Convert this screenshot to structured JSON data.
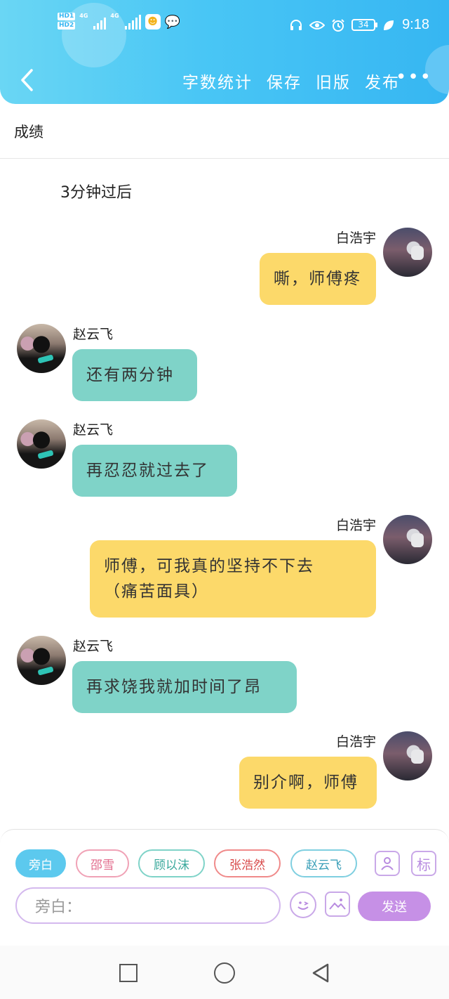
{
  "statusbar": {
    "hd1": "HD1",
    "hd2": "HD2",
    "network1": "4G",
    "network2": "4G",
    "battery": "34",
    "time": "9:18",
    "icons": [
      "headphones-icon",
      "eye-icon",
      "alarm-icon",
      "leaf-icon"
    ]
  },
  "toolbar": {
    "actions": [
      "字数统计",
      "保存",
      "旧版",
      "发布"
    ],
    "more": "•••"
  },
  "document": {
    "title": "成绩"
  },
  "chat": {
    "narration": "3分钟过后",
    "messages": [
      {
        "speaker": "白浩宇",
        "side": "right",
        "text_lines": [
          "嘶，师傅疼"
        ]
      },
      {
        "speaker": "赵云飞",
        "side": "left",
        "text_lines": [
          "还有两分钟"
        ]
      },
      {
        "speaker": "赵云飞",
        "side": "left",
        "text_lines": [
          "再忍忍就过去了"
        ]
      },
      {
        "speaker": "白浩宇",
        "side": "right",
        "text_lines": [
          "师傅，可我真的坚持不下去",
          "（痛苦面具）"
        ]
      },
      {
        "speaker": "赵云飞",
        "side": "left",
        "text_lines": [
          "再求饶我就加时间了昂"
        ]
      },
      {
        "speaker": "白浩宇",
        "side": "right",
        "text_lines": [
          "别介啊，师傅"
        ]
      }
    ]
  },
  "composer": {
    "roles": [
      "旁白",
      "邵雪",
      "顾以沫",
      "张浩然",
      "赵云飞"
    ],
    "active_role": "旁白",
    "tag_icon_label": "标",
    "input_value": "旁白：",
    "send_label": "发送"
  },
  "colors": {
    "header": "#49c6f5",
    "bubble_right": "#fcd96a",
    "bubble_left": "#7fd3c8",
    "send": "#c690e6"
  }
}
